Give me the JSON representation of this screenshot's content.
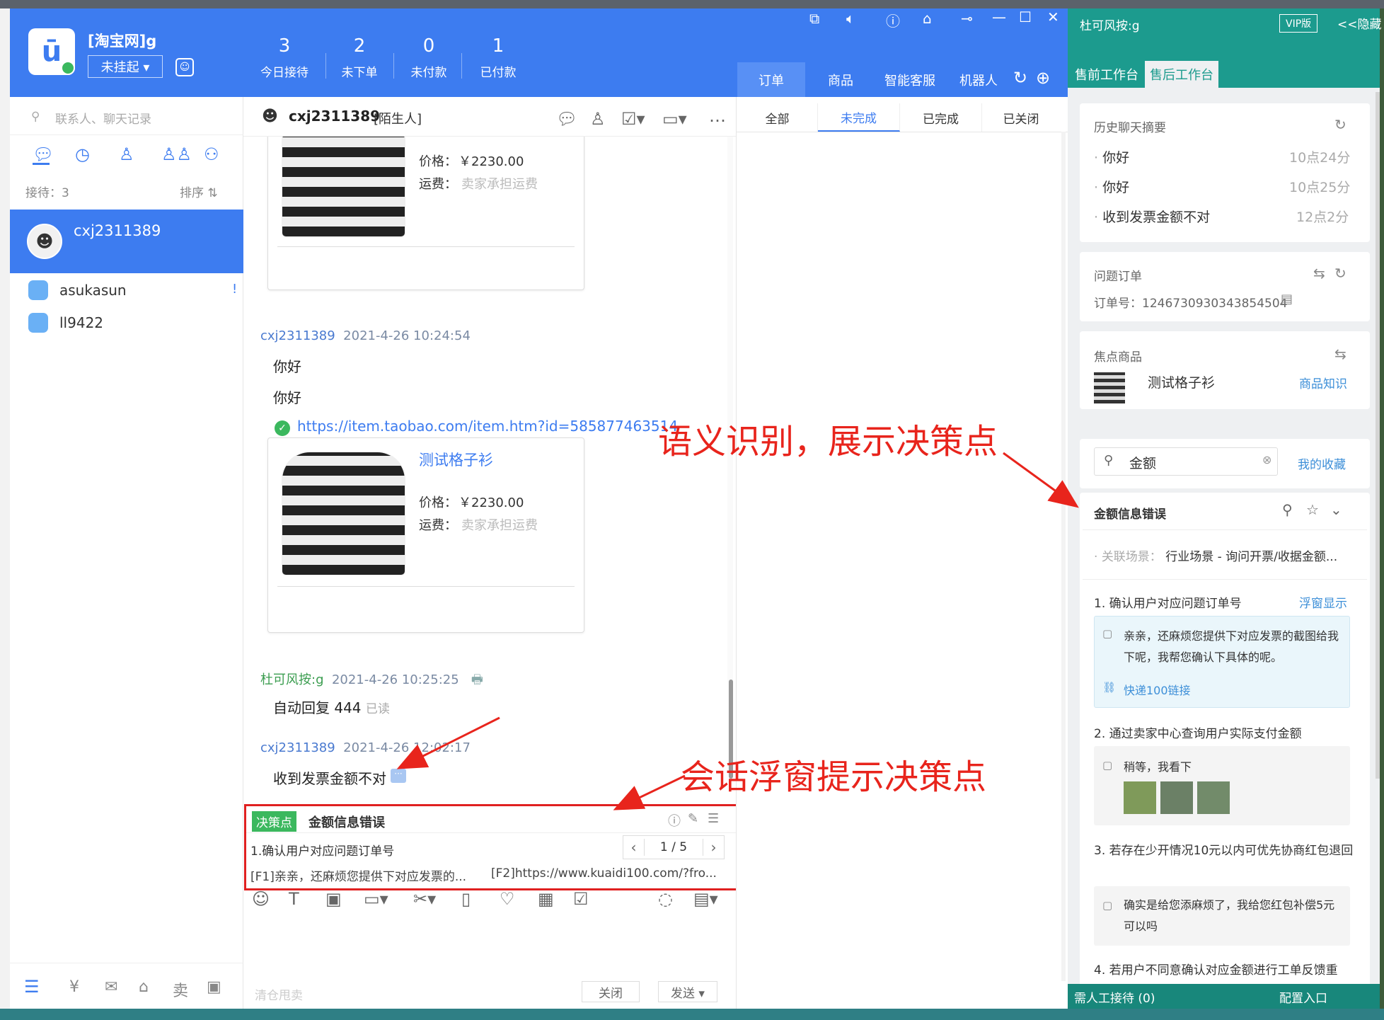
{
  "header": {
    "shop_name": "[淘宝网]g",
    "status_label": "未挂起 ▾",
    "stats": [
      {
        "value": "3",
        "label": "今日接待"
      },
      {
        "value": "2",
        "label": "未下单"
      },
      {
        "value": "0",
        "label": "未付款"
      },
      {
        "value": "1",
        "label": "已付款"
      }
    ],
    "tabs": [
      "订单",
      "商品",
      "智能客服",
      "机器人"
    ]
  },
  "contacts": {
    "search_placeholder": "联系人、聊天记录",
    "count_label": "接待：3",
    "sort_label": "排序 ⇅",
    "items": [
      {
        "name": "cxj2311389"
      },
      {
        "name": "asukasun",
        "badge": "!"
      },
      {
        "name": "ll9422"
      }
    ]
  },
  "chat": {
    "title": "cxj2311389",
    "title_tag": "[陌生人]",
    "product": {
      "name": "测试格子衫",
      "price_label": "价格：",
      "price": "￥2230.00",
      "ship_label": "运费：",
      "ship": "卖家承担运费"
    },
    "messages": [
      {
        "sender": "cxj2311389",
        "time": "2021-4-26 10:24:54",
        "lines": [
          "你好",
          "你好"
        ],
        "link": "https://item.taobao.com/item.htm?id=585877463514"
      },
      {
        "sender": "杜可风按:g",
        "time": "2021-4-26 10:25:25",
        "text": "自动回复 444",
        "read": "已读"
      },
      {
        "sender": "cxj2311389",
        "time": "2021-4-26 12:02:17",
        "text": "收到发票金额不对"
      }
    ],
    "decision": {
      "tag": "决策点",
      "title": "金额信息错误",
      "step": "1.确认用户对应问题订单号",
      "pager": "1 / 5",
      "f1": "[F1]亲亲，还麻烦您提供下对应发票的...",
      "f2": "[F2]https://www.kuaidi100.com/?fro..."
    },
    "input_placeholder": "清仓甩卖",
    "close_label": "关闭",
    "send_label": "发送 ▾"
  },
  "orders": {
    "tabs": [
      "全部",
      "未完成",
      "已完成",
      "已关闭"
    ]
  },
  "right": {
    "title": "杜可风按:g",
    "vip": "VIP版",
    "hide": "<<隐藏",
    "tabs": [
      "售前工作台",
      "售后工作台"
    ],
    "history": {
      "title": "历史聊天摘要",
      "items": [
        {
          "text": "你好",
          "time": "10点24分"
        },
        {
          "text": "你好",
          "time": "10点25分"
        },
        {
          "text": "收到发票金额不对",
          "time": "12点2分"
        }
      ]
    },
    "problem_order": {
      "title": "问题订单",
      "order_label": "订单号：",
      "order_no": "1246730930343854504"
    },
    "focus": {
      "title": "焦点商品",
      "product": "测试格子衫",
      "knowledge": "商品知识"
    },
    "search": {
      "value": "金额",
      "fav": "我的收藏"
    },
    "kb": {
      "title": "金额信息错误",
      "scene_label": "关联场景：",
      "scene": "行业场景 - 询问开票/收据金额...",
      "steps": [
        {
          "title": "1. 确认用户对应问题订单号",
          "action": "浮窗显示",
          "reply": "亲亲，还麻烦您提供下对应发票的截图给我下呢，我帮您确认下具体的呢。",
          "link": "快递100链接"
        },
        {
          "title": "2. 通过卖家中心查询用户实际支付金额",
          "reply": "稍等，我看下"
        },
        {
          "title": "3. 若存在少开情况10元以内可优先协商红包退回",
          "reply": "确实是给您添麻烦了，我给您红包补偿5元可以吗"
        },
        {
          "title": "4. 若用户不同意确认对应金额进行工单反馈重"
        }
      ]
    },
    "footer": {
      "left": "需人工接待 (0)",
      "right": "配置入口"
    }
  },
  "annotations": {
    "a1": "语义识别，展示决策点",
    "a2": "会话浮窗提示决策点"
  }
}
